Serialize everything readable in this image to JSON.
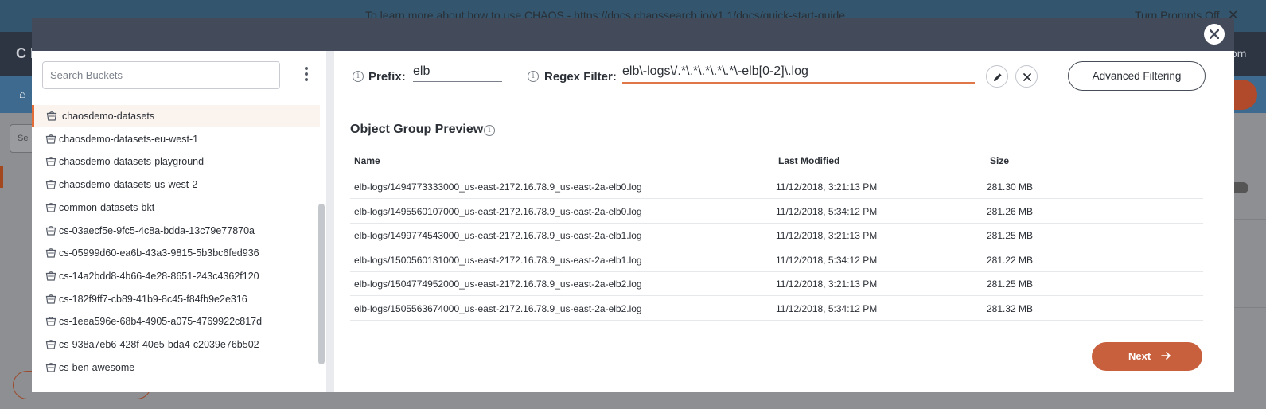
{
  "background": {
    "banner_text": "To learn more about how to use CHAOS - https://docs.chaossearch.io/v1.1/docs/quick-start-guide",
    "banner_right": "Turn Prompts Off",
    "banner_close": "✕",
    "app_logo": "C H",
    "app_right": "om",
    "search_stub": "Se"
  },
  "left": {
    "search_placeholder": "Search Buckets",
    "buckets": [
      "chaosdemo-datasets",
      "chaosdemo-datasets-eu-west-1",
      "chaosdemo-datasets-playground",
      "chaosdemo-datasets-us-west-2",
      "common-datasets-bkt",
      "cs-03aecf5e-9fc5-4c8a-bdda-13c79e77870a",
      "cs-05999d60-ea6b-43a3-9815-5b3bc6fed936",
      "cs-14a2bdd8-4b66-4e28-8651-243c4362f120",
      "cs-182f9ff7-cb89-41b9-8c45-f84fb9e2e316",
      "cs-1eea596e-68b4-4905-a075-4769922c817d",
      "cs-938a7eb6-428f-40e5-bda4-c2039e76b502",
      "cs-ben-awesome"
    ],
    "selected_index": 0
  },
  "filter": {
    "prefix_label": "Prefix:",
    "prefix_value": "elb",
    "regex_label": "Regex Filter:",
    "regex_value": "elb\\-logs\\/.*\\.*\\.*\\.*\\.*\\-elb[0-2]\\.log",
    "advanced_label": "Advanced Filtering"
  },
  "preview": {
    "title": "Object Group Preview",
    "columns": [
      "Name",
      "Last Modified",
      "Size"
    ],
    "rows": [
      [
        "elb-logs/1494773333000_us-east-2172.16.78.9_us-east-2a-elb0.log",
        "11/12/2018, 3:21:13 PM",
        "281.30 MB"
      ],
      [
        "elb-logs/1495560107000_us-east-2172.16.78.9_us-east-2a-elb0.log",
        "11/12/2018, 5:34:12 PM",
        "281.26 MB"
      ],
      [
        "elb-logs/1499774543000_us-east-2172.16.78.9_us-east-2a-elb1.log",
        "11/12/2018, 3:21:13 PM",
        "281.25 MB"
      ],
      [
        "elb-logs/1500560131000_us-east-2172.16.78.9_us-east-2a-elb1.log",
        "11/12/2018, 5:34:12 PM",
        "281.22 MB"
      ],
      [
        "elb-logs/1504774952000_us-east-2172.16.78.9_us-east-2a-elb2.log",
        "11/12/2018, 3:21:13 PM",
        "281.25 MB"
      ],
      [
        "elb-logs/1505563674000_us-east-2172.16.78.9_us-east-2a-elb2.log",
        "11/12/2018, 5:34:12 PM",
        "281.32 MB"
      ]
    ]
  },
  "footer": {
    "next_label": "Next"
  },
  "icons": {
    "close": "close-icon",
    "kebab": "kebab-menu-icon",
    "bucket": "bucket-icon",
    "info": "info-icon",
    "pencil": "pencil-icon",
    "clear": "clear-icon",
    "arrow": "arrow-right-icon"
  },
  "colors": {
    "accent": "#e36d38",
    "next_button": "#c8603e",
    "modal_header": "#434a5a"
  }
}
